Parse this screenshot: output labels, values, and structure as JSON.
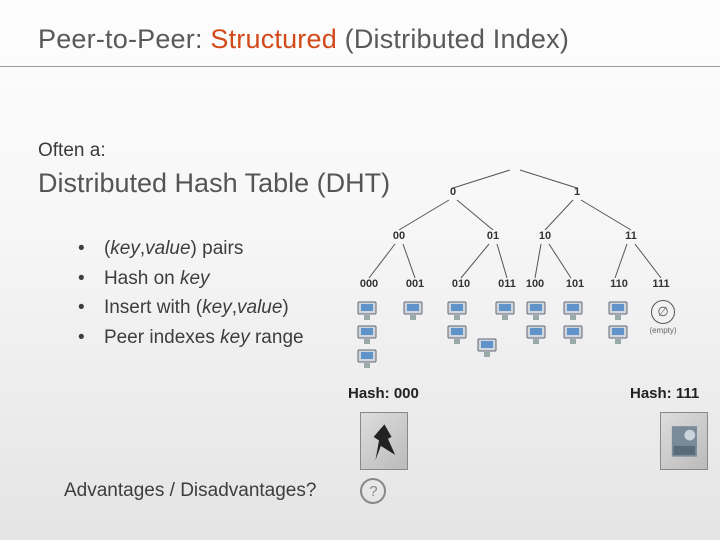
{
  "title": {
    "pre": "Peer-to-Peer: ",
    "accent": "Structured",
    "post": " (Distributed Index)"
  },
  "lead": "Often a:",
  "subtitle": "Distributed Hash Table (DHT)",
  "bullets": {
    "b1": {
      "pre": "(",
      "k": "key",
      "mid": ",",
      "v": "value",
      "post": ") pairs"
    },
    "b2": {
      "pre": "Hash on ",
      "k": "key"
    },
    "b3": {
      "pre": "Insert with (",
      "k": "key",
      "mid": ",",
      "v": "value",
      "post": ")"
    },
    "b4": {
      "pre": "Peer indexes ",
      "k": "key",
      "post": " range"
    }
  },
  "tree": {
    "level0": [
      "0",
      "1"
    ],
    "level1": [
      "00",
      "01",
      "10",
      "11"
    ],
    "level2": [
      "000",
      "001",
      "010",
      "011",
      "100",
      "101",
      "110",
      "111"
    ],
    "empty_label": "(empty)"
  },
  "hash_left": "Hash: 000",
  "hash_right": "Hash: 111",
  "question": {
    "text": "Advantages / Disadvantages?",
    "badge": "?"
  }
}
